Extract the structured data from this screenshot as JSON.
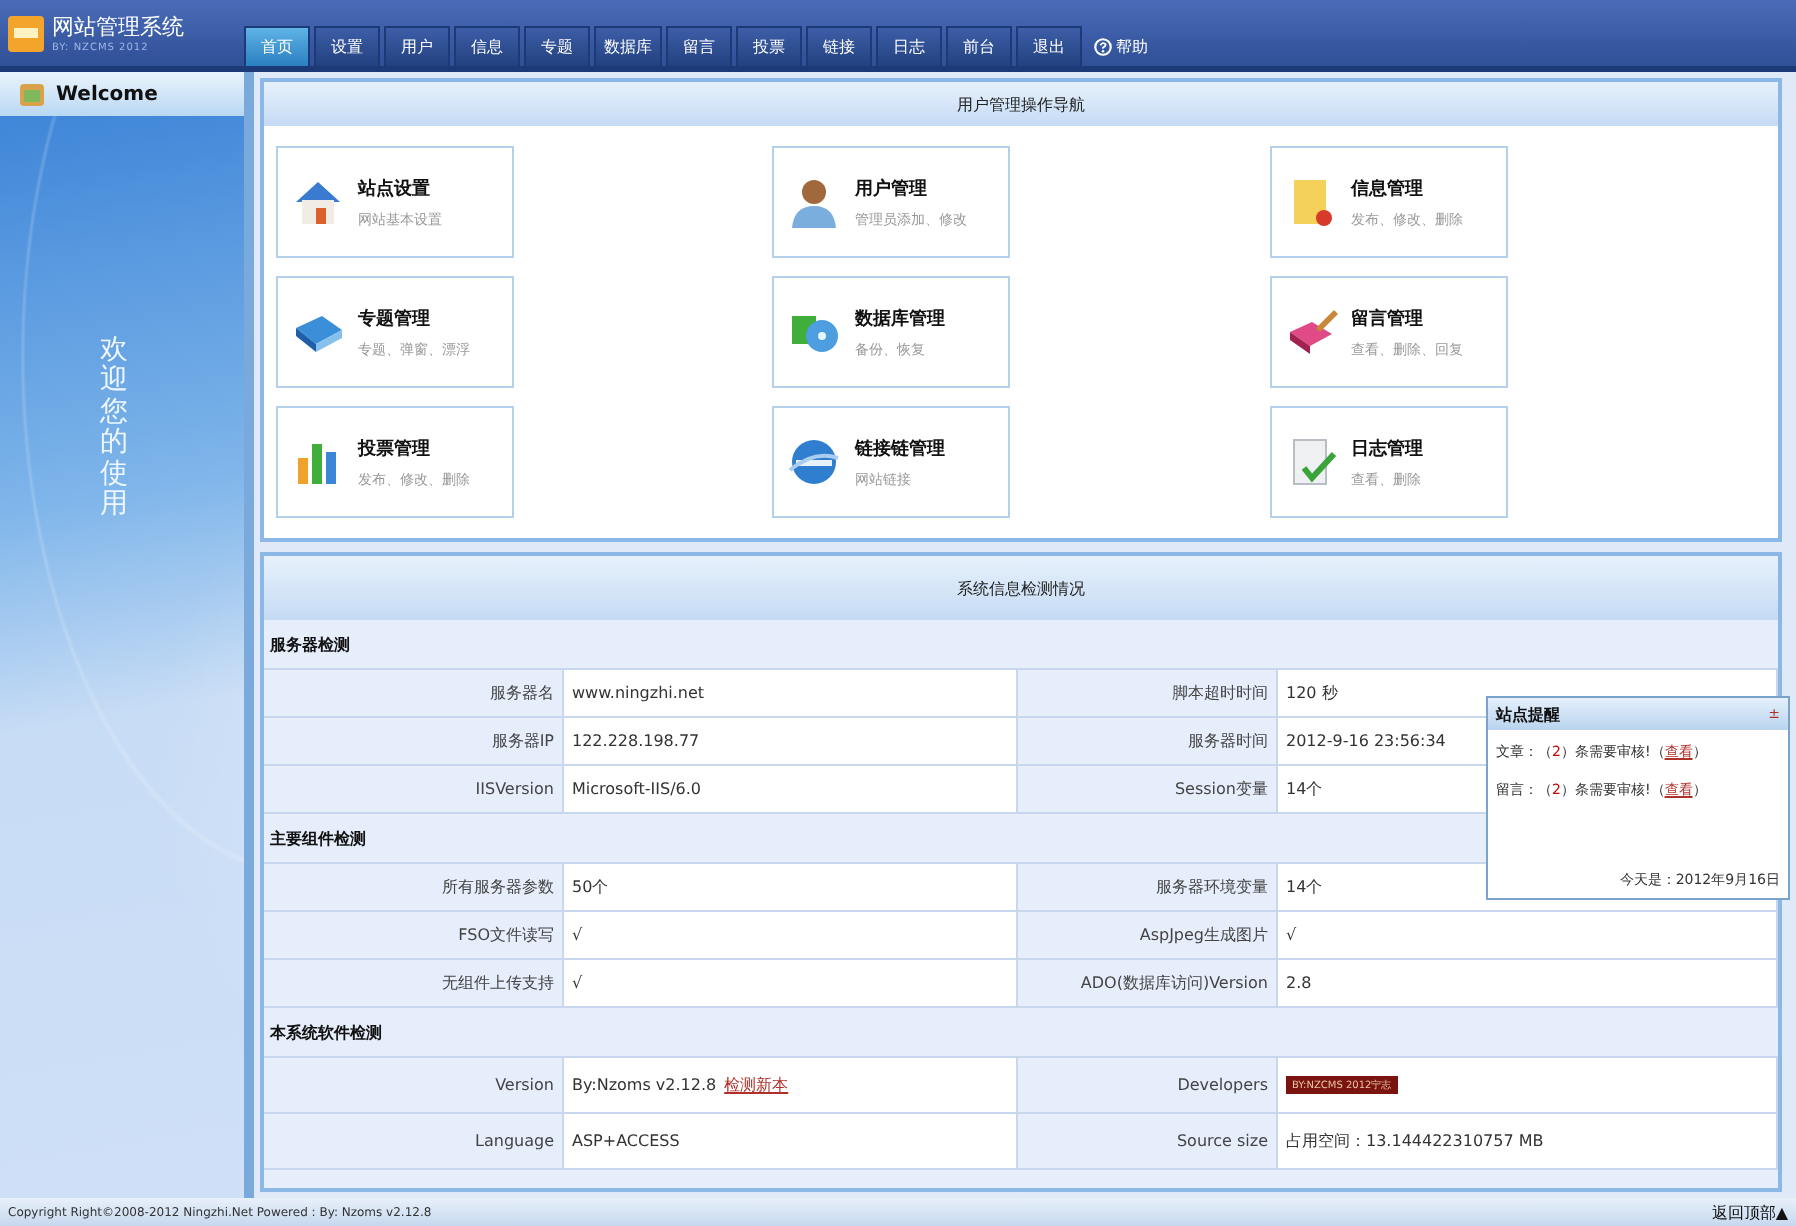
{
  "header": {
    "title": "网站管理系统",
    "subtitle": "BY: NZCMS 2012"
  },
  "nav": [
    {
      "label": "首页",
      "selected": true
    },
    {
      "label": "设置",
      "selected": false
    },
    {
      "label": "用户",
      "selected": false
    },
    {
      "label": "信息",
      "selected": false
    },
    {
      "label": "专题",
      "selected": false
    },
    {
      "label": "数据库",
      "selected": false
    },
    {
      "label": "留言",
      "selected": false
    },
    {
      "label": "投票",
      "selected": false
    },
    {
      "label": "链接",
      "selected": false
    },
    {
      "label": "日志",
      "selected": false
    },
    {
      "label": "前台",
      "selected": false
    },
    {
      "label": "退出",
      "selected": false
    }
  ],
  "help": "帮助",
  "sidebar": {
    "title": "Welcome",
    "greeting": "欢迎您的使用"
  },
  "nav_panel": {
    "title": "用户管理操作导航",
    "cards": [
      {
        "title": "站点设置",
        "desc": "网站基本设置"
      },
      {
        "title": "用户管理",
        "desc": "管理员添加、修改"
      },
      {
        "title": "信息管理",
        "desc": "发布、修改、删除"
      },
      {
        "title": "专题管理",
        "desc": "专题、弹窗、漂浮"
      },
      {
        "title": "数据库管理",
        "desc": "备份、恢复"
      },
      {
        "title": "留言管理",
        "desc": "查看、删除、回复"
      },
      {
        "title": "投票管理",
        "desc": "发布、修改、删除"
      },
      {
        "title": "链接链管理",
        "desc": "网站链接"
      },
      {
        "title": "日志管理",
        "desc": "查看、删除"
      }
    ]
  },
  "info_panel": {
    "title": "系统信息检测情况",
    "sections": [
      {
        "title": "服务器检测",
        "rows": [
          {
            "label_1": "服务器名",
            "value_1": "www.ningzhi.net",
            "label_2": "脚本超时时间",
            "value_2": "120 秒"
          },
          {
            "label_1": "服务器IP",
            "value_1": "122.228.198.77",
            "label_2": "服务器时间",
            "value_2": "2012-9-16 23:56:34"
          },
          {
            "label_1": "IISVersion",
            "value_1": "Microsoft-IIS/6.0",
            "label_2": "Session变量",
            "value_2": "14个"
          }
        ]
      },
      {
        "title": "主要组件检测",
        "rows": [
          {
            "label_1": "所有服务器参数",
            "value_1": "50个",
            "label_2": "服务器环境变量",
            "value_2": "14个"
          },
          {
            "label_1": "FSO文件读写",
            "value_1": "√",
            "label_2": "AspJpeg生成图片",
            "value_2": "√"
          },
          {
            "label_1": "无组件上传支持",
            "value_1": "√",
            "label_2": "ADO(数据库访问)Version",
            "value_2": "2.8"
          }
        ]
      },
      {
        "title": "本系统软件检测",
        "rows": [
          {
            "label_1": "Version",
            "value_1": "By:Nzoms v2.12.8",
            "link": "检测新本",
            "label_2": "Developers",
            "badge": "BY:NZCMS 2012宁志"
          },
          {
            "label_1": "Language",
            "value_1": "ASP+ACCESS",
            "label_2": "Source size",
            "value_2": "占用空间：13.144422310757 MB"
          }
        ]
      }
    ]
  },
  "popup": {
    "title": "站点提醒",
    "close": "±",
    "lines": [
      {
        "prefix": "文章：（",
        "count": "2",
        "suffix": "）条需要审核!（",
        "link": "查看",
        "end": "）"
      },
      {
        "prefix": "留言：（",
        "count": "2",
        "suffix": "）条需要审核!（",
        "link": "查看",
        "end": "）"
      }
    ],
    "date": "今天是：2012年9月16日"
  },
  "footer": {
    "copyright": "Copyright Right©2008-2012 Ningzhi.Net Powered : By: Nzoms v2.12.8",
    "back_to_top": "返回顶部▲"
  }
}
